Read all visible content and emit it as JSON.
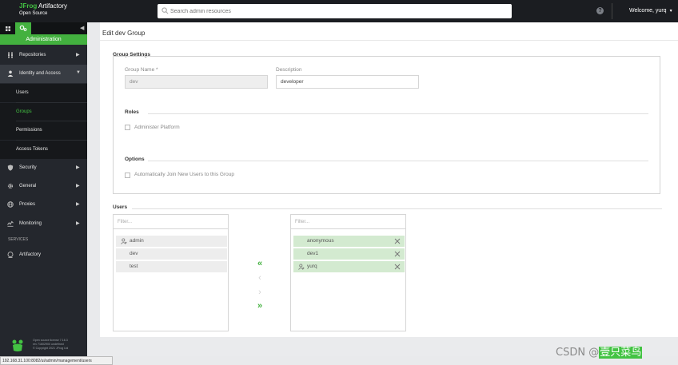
{
  "app": {
    "brand_word": "JFrog",
    "product": "Artifactory",
    "edition": "Open Source"
  },
  "topbar": {
    "search_placeholder": "Search admin resources",
    "help_glyph": "?",
    "welcome": "Welcome, yurq"
  },
  "sidebar": {
    "admin_label": "Administration",
    "items": [
      {
        "label": "Repositories",
        "icon": "repositories-icon"
      },
      {
        "label": "Identity and Access",
        "icon": "person-icon"
      },
      {
        "label": "Security",
        "icon": "shield-icon"
      },
      {
        "label": "General",
        "icon": "gear-icon"
      },
      {
        "label": "Proxies",
        "icon": "globe-icon"
      },
      {
        "label": "Monitoring",
        "icon": "monitoring-icon"
      }
    ],
    "sub_items": [
      {
        "label": "Users"
      },
      {
        "label": "Groups"
      },
      {
        "label": "Permissions"
      },
      {
        "label": "Access Tokens"
      }
    ],
    "services_header": "SERVICES",
    "service_item": "Artifactory",
    "footer": {
      "line1": "Open source license 7.16.3",
      "line2": "rev 71602900 undefined",
      "line3": "© Copyright 2021 JFrog Ltd"
    }
  },
  "page": {
    "title": "Edit dev Group",
    "group_settings": {
      "title": "Group Settings",
      "group_name_label": "Group Name *",
      "group_name_value": "dev",
      "description_label": "Description",
      "description_value": "developer"
    },
    "roles": {
      "title": "Roles",
      "admin_platform_label": "Administer Platform"
    },
    "options": {
      "title": "Options",
      "auto_join_label": "Automatically Join New Users to this Group"
    },
    "users": {
      "title": "Users",
      "filter_placeholder": "Filter...",
      "available": [
        {
          "name": "admin",
          "admin": true
        },
        {
          "name": "dev",
          "admin": false
        },
        {
          "name": "test",
          "admin": false
        }
      ],
      "selected": [
        {
          "name": "anonymous",
          "admin": false
        },
        {
          "name": "dev1",
          "admin": false
        },
        {
          "name": "yurq",
          "admin": true
        }
      ],
      "move_all_left": "«",
      "move_left": "‹",
      "move_right": "›",
      "move_all_right": "»"
    }
  },
  "statusbar": {
    "url": "192.168.31.100:8082/ui/admin/management/users"
  },
  "watermark": {
    "prefix": "CSDN @",
    "highlight": "壹只菜鸟"
  },
  "colors": {
    "accent": "#43b13f",
    "topbar": "#1b1d21",
    "sidebar": "#24272d"
  }
}
